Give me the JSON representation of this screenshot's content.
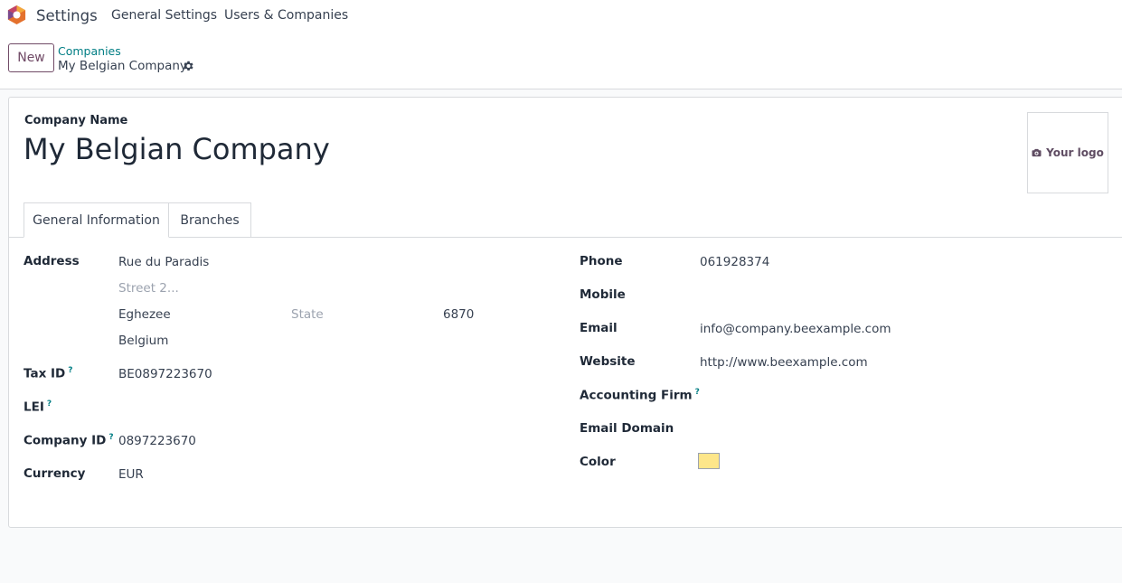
{
  "topbar": {
    "app_name": "Settings",
    "menu": [
      "General Settings",
      "Users & Companies"
    ]
  },
  "control": {
    "new_label": "New",
    "breadcrumb_parent": "Companies",
    "breadcrumb_current": "My Belgian Company"
  },
  "form": {
    "company_name_label": "Company Name",
    "company_name": "My Belgian Company",
    "logo_label": "Your logo",
    "tabs": [
      "General Information",
      "Branches"
    ],
    "address": {
      "label": "Address",
      "street": "Rue du Paradis",
      "street2_placeholder": "Street 2...",
      "city": "Eghezee",
      "state_placeholder": "State",
      "zip": "6870",
      "country": "Belgium"
    },
    "tax_id": {
      "label": "Tax ID",
      "help": "?",
      "value": "BE0897223670"
    },
    "lei": {
      "label": "LEI",
      "help": "?",
      "value": ""
    },
    "company_id": {
      "label": "Company ID",
      "help": "?",
      "value": "0897223670"
    },
    "currency": {
      "label": "Currency",
      "value": "EUR"
    },
    "phone": {
      "label": "Phone",
      "value": "061928374"
    },
    "mobile": {
      "label": "Mobile",
      "value": ""
    },
    "email": {
      "label": "Email",
      "value": "info@company.beexample.com"
    },
    "website": {
      "label": "Website",
      "value": "http://www.beexample.com"
    },
    "accounting_firm": {
      "label": "Accounting Firm",
      "help": "?",
      "value": ""
    },
    "email_domain": {
      "label": "Email Domain",
      "value": ""
    },
    "color": {
      "label": "Color",
      "value": "#fde68a"
    }
  },
  "colors": {
    "brand": "#714b67",
    "link": "#017e84"
  },
  "icons": {
    "app_logo": "odoo-logo-icon",
    "gear": "gear-icon",
    "camera": "camera-icon"
  }
}
